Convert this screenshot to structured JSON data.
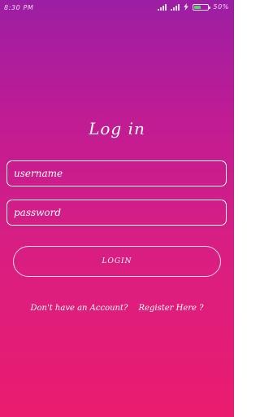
{
  "status_bar": {
    "time": "8:30 PM",
    "battery_percent": "50%",
    "battery_level": 0.5,
    "icons": [
      "signal-bars-icon",
      "signal-bars-icon",
      "charging-bolt-icon",
      "battery-icon"
    ]
  },
  "login": {
    "title": "Log in",
    "username_placeholder": "username",
    "password_placeholder": "password",
    "login_button": "LOGIN"
  },
  "register": {
    "prompt": "Don't have an Account?",
    "link": "Register Here ?"
  },
  "colors": {
    "gradient_top": "#9c1ea4",
    "gradient_bottom": "#ea1c6e",
    "text": "#ffffff",
    "battery_fill": "#4cd964"
  }
}
